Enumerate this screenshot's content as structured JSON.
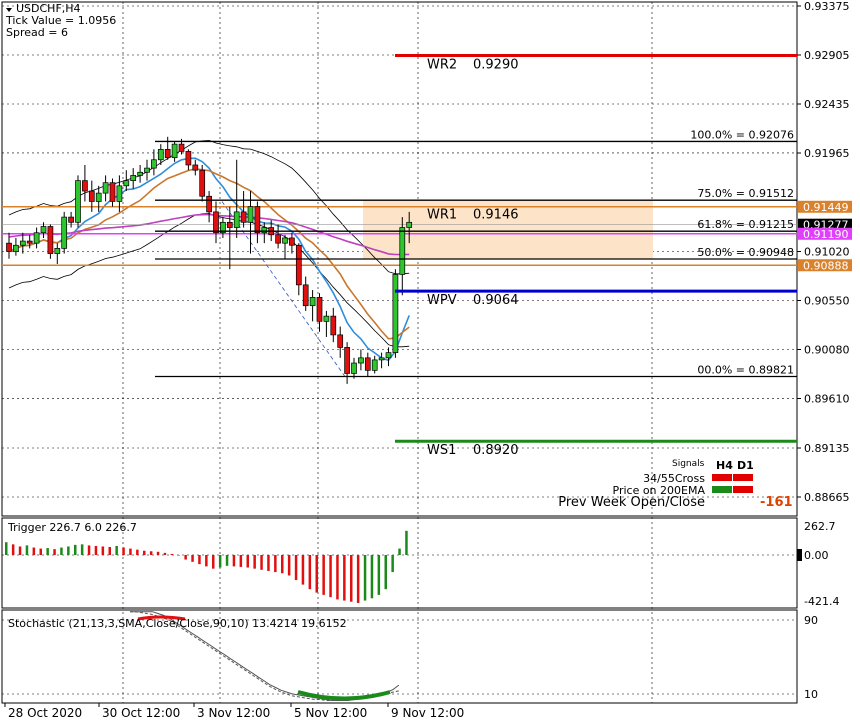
{
  "symbol_header": {
    "symbol": "USDCHF,H4",
    "tick_value": "Tick Value = 1.0956",
    "spread": "Spread = 6"
  },
  "price_axis": [
    "0.93375",
    "0.92905",
    "0.92435",
    "0.91965",
    "0.91020",
    "0.90550",
    "0.90080",
    "0.89610",
    "0.89135",
    "0.88665"
  ],
  "price_tags": [
    {
      "text": "0.91449",
      "bg": "#d9822b",
      "price": 0.91449
    },
    {
      "text": "0.91277",
      "bg": "#000000",
      "price": 0.91277
    },
    {
      "text": "0.91190",
      "bg": "#e040fb",
      "price": 0.9119
    },
    {
      "text": "0.90888",
      "bg": "#d9822b",
      "price": 0.90888
    }
  ],
  "pivot_levels": [
    {
      "name": "WR2",
      "value": "0.9290",
      "price": 0.929,
      "color": "#e00000"
    },
    {
      "name": "WR1",
      "value": "0.9146",
      "price": 0.9146,
      "color": "#e8a46a"
    },
    {
      "name": "WPV",
      "value": "0.9064",
      "price": 0.9064,
      "color": "#0000cc"
    },
    {
      "name": "WS1",
      "value": "0.8920",
      "price": 0.892,
      "color": "#1a8a1a"
    }
  ],
  "fib_levels": [
    {
      "label": "100.0% = 0.92076",
      "price": 0.92076
    },
    {
      "label": "75.0% = 0.91512",
      "price": 0.91512
    },
    {
      "label": "61.8% = 0.91215",
      "price": 0.91215
    },
    {
      "label": "50.0% = 0.90948",
      "price": 0.90948
    },
    {
      "label": "00.0% = 0.89821",
      "price": 0.89821
    }
  ],
  "signals": {
    "title": "Signals",
    "col_h4": "H4",
    "col_d1": "D1",
    "rows": [
      {
        "label": "34/55Cross",
        "h4": "#e00000",
        "d1": "#e00000"
      },
      {
        "label": "Price on 200EMA",
        "h4": "#1a8a1a",
        "d1": "#e00000"
      }
    ],
    "prev_week_label": "Prev Week Open/Close",
    "prev_week_value": "-161",
    "prev_week_color": "#e04000"
  },
  "trigger_panel": {
    "title": "Trigger 226.7 6.0 226.7",
    "axis": [
      "262.7",
      "0.00",
      "-421.4"
    ]
  },
  "stochastic_panel": {
    "title": "Stochastic (21,13,3,SMA,Close/Close,90,10) 13.4214 19.6152",
    "axis": [
      "90",
      "10"
    ]
  },
  "time_axis": [
    "28 Oct 2020",
    "30 Oct 12:00",
    "3 Nov 12:00",
    "5 Nov 12:00",
    "9 Nov 12:00"
  ],
  "candles": [
    [
      0.911,
      0.912,
      0.9095,
      0.9102
    ],
    [
      0.9102,
      0.9115,
      0.9098,
      0.9108
    ],
    [
      0.9108,
      0.912,
      0.91,
      0.9112
    ],
    [
      0.9112,
      0.9118,
      0.9105,
      0.911
    ],
    [
      0.911,
      0.9125,
      0.9105,
      0.912
    ],
    [
      0.912,
      0.913,
      0.9115,
      0.9126
    ],
    [
      0.9126,
      0.9128,
      0.9095,
      0.91
    ],
    [
      0.91,
      0.911,
      0.909,
      0.9105
    ],
    [
      0.9105,
      0.914,
      0.91,
      0.9135
    ],
    [
      0.9135,
      0.914,
      0.9125,
      0.913
    ],
    [
      0.913,
      0.9175,
      0.9125,
      0.917
    ],
    [
      0.917,
      0.9185,
      0.915,
      0.916
    ],
    [
      0.916,
      0.917,
      0.914,
      0.915
    ],
    [
      0.915,
      0.9165,
      0.914,
      0.9158
    ],
    [
      0.9158,
      0.9175,
      0.915,
      0.9168
    ],
    [
      0.9168,
      0.9172,
      0.9145,
      0.915
    ],
    [
      0.915,
      0.9175,
      0.914,
      0.9165
    ],
    [
      0.9165,
      0.918,
      0.916,
      0.917
    ],
    [
      0.917,
      0.9182,
      0.9162,
      0.9175
    ],
    [
      0.9175,
      0.9185,
      0.9168,
      0.9178
    ],
    [
      0.9178,
      0.919,
      0.917,
      0.9182
    ],
    [
      0.9182,
      0.92,
      0.9175,
      0.919
    ],
    [
      0.919,
      0.9205,
      0.9185,
      0.92
    ],
    [
      0.92,
      0.9212,
      0.919,
      0.9192
    ],
    [
      0.9192,
      0.9208,
      0.9188,
      0.9205
    ],
    [
      0.9205,
      0.921,
      0.9195,
      0.9198
    ],
    [
      0.9198,
      0.92,
      0.918,
      0.9185
    ],
    [
      0.9185,
      0.919,
      0.9175,
      0.918
    ],
    [
      0.918,
      0.9185,
      0.915,
      0.9155
    ],
    [
      0.9155,
      0.916,
      0.913,
      0.914
    ],
    [
      0.914,
      0.915,
      0.911,
      0.912
    ],
    [
      0.912,
      0.9135,
      0.9115,
      0.913
    ],
    [
      0.913,
      0.9145,
      0.9085,
      0.9125
    ],
    [
      0.9125,
      0.919,
      0.9115,
      0.914
    ],
    [
      0.914,
      0.916,
      0.9125,
      0.913
    ],
    [
      0.913,
      0.916,
      0.91,
      0.9145
    ],
    [
      0.9145,
      0.915,
      0.911,
      0.912
    ],
    [
      0.912,
      0.913,
      0.911,
      0.9125
    ],
    [
      0.9125,
      0.9132,
      0.9112,
      0.9118
    ],
    [
      0.9118,
      0.9128,
      0.9105,
      0.911
    ],
    [
      0.911,
      0.9118,
      0.9095,
      0.9115
    ],
    [
      0.9115,
      0.912,
      0.91,
      0.9108
    ],
    [
      0.9108,
      0.911,
      0.906,
      0.907
    ],
    [
      0.907,
      0.9078,
      0.9045,
      0.905
    ],
    [
      0.905,
      0.9065,
      0.9035,
      0.9058
    ],
    [
      0.9058,
      0.9062,
      0.9025,
      0.9035
    ],
    [
      0.9035,
      0.9045,
      0.902,
      0.904
    ],
    [
      0.904,
      0.9048,
      0.9015,
      0.9022
    ],
    [
      0.9022,
      0.903,
      0.9,
      0.901
    ],
    [
      0.901,
      0.9015,
      0.8975,
      0.8985
    ],
    [
      0.8985,
      0.9,
      0.898,
      0.8995
    ],
    [
      0.8995,
      0.9008,
      0.8988,
      0.9
    ],
    [
      0.9,
      0.9005,
      0.8982,
      0.8988
    ],
    [
      0.8988,
      0.9002,
      0.8985,
      0.8998
    ],
    [
      0.8998,
      0.9005,
      0.899,
      0.9
    ],
    [
      0.9,
      0.901,
      0.8992,
      0.9005
    ],
    [
      0.9005,
      0.9085,
      0.9,
      0.908
    ],
    [
      0.908,
      0.9135,
      0.906,
      0.9125
    ],
    [
      0.9125,
      0.914,
      0.911,
      0.913
    ]
  ],
  "trigger_values": [
    120,
    100,
    80,
    90,
    70,
    60,
    65,
    55,
    70,
    80,
    95,
    100,
    90,
    85,
    80,
    75,
    85,
    70,
    60,
    50,
    40,
    35,
    30,
    20,
    10,
    0,
    -40,
    -60,
    -80,
    -100,
    -120,
    -110,
    -95,
    -100,
    -105,
    -110,
    -120,
    -130,
    -140,
    -150,
    -160,
    -180,
    -220,
    -260,
    -300,
    -330,
    -350,
    -370,
    -390,
    -400,
    -410,
    -421,
    -400,
    -380,
    -350,
    -300,
    -150,
    60,
    226.7
  ],
  "stoch_main": [
    99,
    99,
    99,
    99,
    99,
    97,
    95,
    92,
    88,
    84,
    80,
    76,
    72,
    68,
    64,
    60,
    56,
    52,
    48,
    44,
    40,
    36,
    32,
    28,
    24,
    20,
    17,
    14,
    12,
    10,
    9,
    8,
    7,
    6,
    5,
    4,
    3,
    3,
    3,
    3,
    4,
    5,
    6,
    7,
    8,
    10,
    12,
    15,
    19.6
  ],
  "stoch_signal": [
    99,
    99,
    98,
    97,
    96,
    94,
    92,
    90,
    86,
    82,
    78,
    74,
    70,
    66,
    62,
    58,
    54,
    50,
    46,
    42,
    38,
    34,
    30,
    26,
    22,
    18,
    15,
    12,
    10,
    8,
    7,
    6,
    5,
    4,
    4,
    3,
    3,
    3,
    4,
    4,
    5,
    6,
    7,
    8,
    9,
    10,
    11,
    12,
    13.4
  ]
}
